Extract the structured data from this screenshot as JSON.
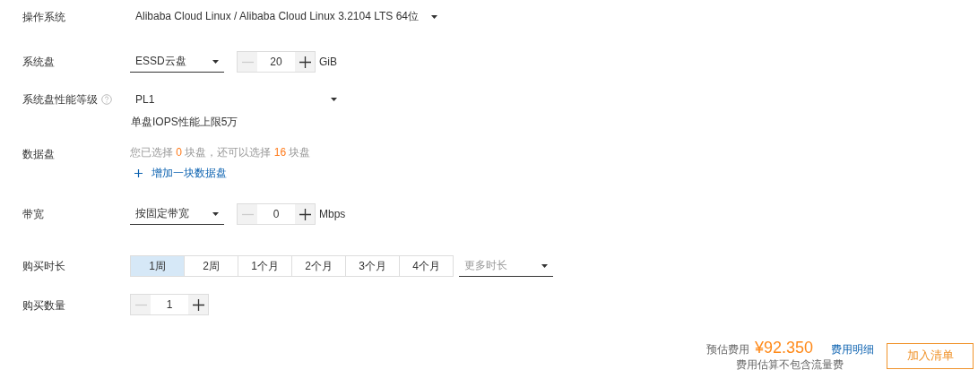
{
  "rows": [
    {
      "kind": "select",
      "label": "操作系统",
      "value": "Alibaba Cloud Linux / Alibaba Cloud Linux 3.2104 LTS 64位",
      "underline": false
    },
    {
      "kind": "select-stepper",
      "label": "系统盘",
      "value": "ESSD云盘",
      "underline": true,
      "stepper": {
        "value": "20",
        "minus_disabled": true
      },
      "unit": "GiB"
    },
    {
      "kind": "select-note",
      "label": "系统盘性能等级",
      "help": true,
      "value": "PL1",
      "underline": false,
      "note": "单盘IOPS性能上限5万"
    },
    {
      "kind": "disks",
      "label": "数据盘",
      "summary": [
        {
          "text": "您已选择 ",
          "highlight": false
        },
        {
          "text": "0",
          "highlight": true
        },
        {
          "text": " 块盘，还可以选择 ",
          "highlight": false
        },
        {
          "text": "16",
          "highlight": true
        },
        {
          "text": " 块盘",
          "highlight": false
        }
      ],
      "add_link": "增加一块数据盘"
    },
    {
      "kind": "select-stepper",
      "label": "带宽",
      "value": "按固定带宽",
      "underline": true,
      "stepper": {
        "value": "0",
        "minus_disabled": true
      },
      "unit": "Mbps"
    },
    {
      "kind": "periods",
      "label": "购买时长",
      "options": [
        {
          "label": "1周",
          "selected": true
        },
        {
          "label": "2周",
          "selected": false
        },
        {
          "label": "1个月",
          "selected": false
        },
        {
          "label": "2个月",
          "selected": false
        },
        {
          "label": "3个月",
          "selected": false
        },
        {
          "label": "4个月",
          "selected": false
        }
      ],
      "more": "更多时长"
    },
    {
      "kind": "stepper",
      "label": "购买数量",
      "stepper": {
        "value": "1",
        "minus_disabled": true
      }
    }
  ],
  "footer": {
    "price_label": "预估费用",
    "price": "¥92.350",
    "detail_link": "费用明细",
    "note": "费用估算不包含流量费",
    "button": "加入清单"
  }
}
